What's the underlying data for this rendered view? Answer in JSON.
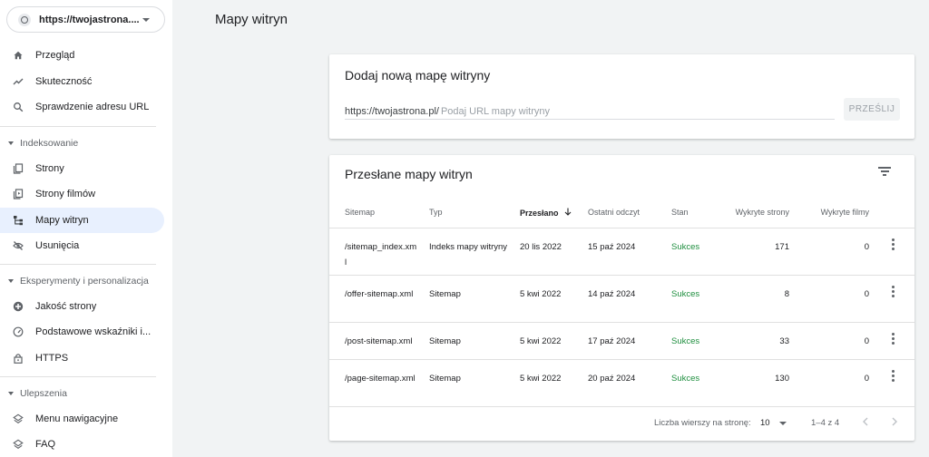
{
  "property": {
    "url": "https://twojastrona...."
  },
  "sidebar": {
    "top_items": [
      {
        "label": "Przegląd",
        "icon": "home-icon"
      },
      {
        "label": "Skuteczność",
        "icon": "trending-icon"
      },
      {
        "label": "Sprawdzenie adresu URL",
        "icon": "search-icon"
      }
    ],
    "sections": [
      {
        "title": "Indeksowanie",
        "items": [
          {
            "label": "Strony",
            "icon": "pages-icon"
          },
          {
            "label": "Strony filmów",
            "icon": "video-pages-icon"
          },
          {
            "label": "Mapy witryn",
            "icon": "sitemap-icon",
            "active": true
          },
          {
            "label": "Usunięcia",
            "icon": "removals-icon"
          }
        ]
      },
      {
        "title": "Eksperymenty i personalizacja",
        "items": [
          {
            "label": "Jakość strony",
            "icon": "page-quality-icon"
          },
          {
            "label": "Podstawowe wskaźniki i...",
            "icon": "gauge-icon"
          },
          {
            "label": "HTTPS",
            "icon": "lock-icon"
          }
        ]
      },
      {
        "title": "Ulepszenia",
        "items": [
          {
            "label": "Menu nawigacyjne",
            "icon": "layers-icon"
          },
          {
            "label": "FAQ",
            "icon": "layers-icon"
          }
        ]
      }
    ]
  },
  "page": {
    "title": "Mapy witryn"
  },
  "add_sitemap": {
    "title": "Dodaj nową mapę witryny",
    "prefix": "https://twojastrona.pl/",
    "placeholder": "Podaj URL mapy witryny",
    "submit_label": "PRZEŚLIJ"
  },
  "submitted": {
    "title": "Przesłane mapy witryn",
    "columns": {
      "sitemap": "Sitemap",
      "type": "Typ",
      "submitted": "Przesłano",
      "last_read": "Ostatni odczyt",
      "status": "Stan",
      "pages": "Wykryte strony",
      "videos": "Wykryte filmy"
    },
    "rows": [
      {
        "sitemap": "/sitemap_index.xml",
        "type": "Indeks mapy witryny",
        "submitted": "20 lis 2022",
        "last_read": "15 paź 2024",
        "status": "Sukces",
        "pages": "171",
        "videos": "0"
      },
      {
        "sitemap": "/offer-sitemap.xml",
        "type": "Sitemap",
        "submitted": "5 kwi 2022",
        "last_read": "14 paź 2024",
        "status": "Sukces",
        "pages": "8",
        "videos": "0"
      },
      {
        "sitemap": "/post-sitemap.xml",
        "type": "Sitemap",
        "submitted": "5 kwi 2022",
        "last_read": "17 paź 2024",
        "status": "Sukces",
        "pages": "33",
        "videos": "0"
      },
      {
        "sitemap": "/page-sitemap.xml",
        "type": "Sitemap",
        "submitted": "5 kwi 2022",
        "last_read": "20 paź 2024",
        "status": "Sukces",
        "pages": "130",
        "videos": "0"
      }
    ],
    "footer": {
      "rows_per_page_label": "Liczba wierszy na stronę:",
      "rows_per_page": "10",
      "range": "1–4 z 4"
    }
  },
  "colors": {
    "success": "#1e8e3e",
    "active_nav": "#e8f0fe"
  }
}
